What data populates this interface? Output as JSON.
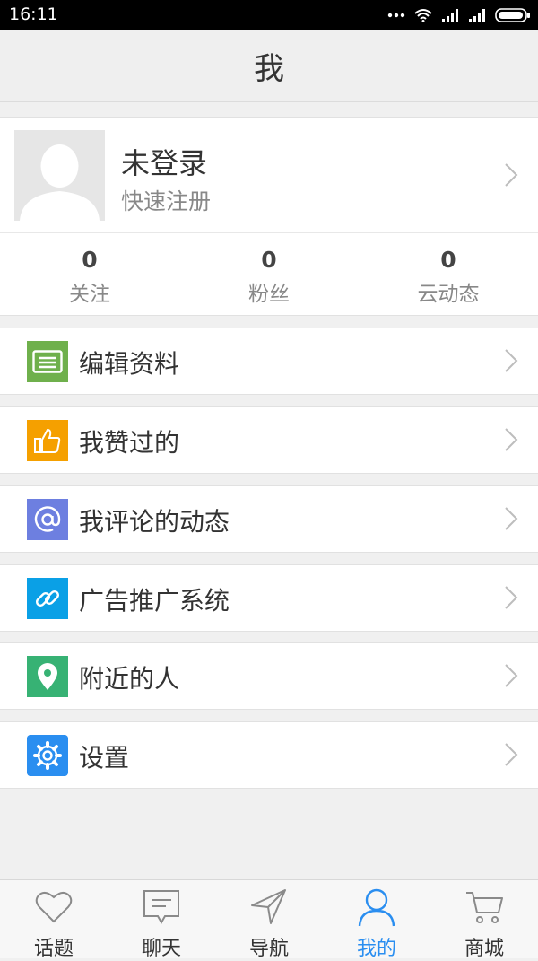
{
  "status": {
    "time": "16:11"
  },
  "header": {
    "title": "我"
  },
  "profile": {
    "name": "未登录",
    "register_label": "快速注册",
    "stats": [
      {
        "count": "0",
        "label": "关注"
      },
      {
        "count": "0",
        "label": "粉丝"
      },
      {
        "count": "0",
        "label": "云动态"
      }
    ]
  },
  "menu": [
    {
      "label": "编辑资料",
      "icon": "edit-profile-icon",
      "color": "#6fb04c"
    },
    {
      "label": "我赞过的",
      "icon": "thumbs-up-icon",
      "color": "#f5a000"
    },
    {
      "label": "我评论的动态",
      "icon": "at-icon",
      "color": "#6d7fe0"
    },
    {
      "label": "广告推广系统",
      "icon": "link-icon",
      "color": "#0aa0e6"
    },
    {
      "label": "附近的人",
      "icon": "location-pin-icon",
      "color": "#37b274"
    },
    {
      "label": "设置",
      "icon": "gear-icon",
      "color": "#2a8ef0"
    }
  ],
  "tabs": [
    {
      "label": "话题",
      "icon": "heart-icon"
    },
    {
      "label": "聊天",
      "icon": "chat-bubble-icon"
    },
    {
      "label": "导航",
      "icon": "navigation-arrow-icon"
    },
    {
      "label": "我的",
      "icon": "user-icon",
      "active": true
    },
    {
      "label": "商城",
      "icon": "cart-icon"
    }
  ],
  "colors": {
    "accent": "#2a8ef0",
    "background": "#f0f0f0"
  }
}
